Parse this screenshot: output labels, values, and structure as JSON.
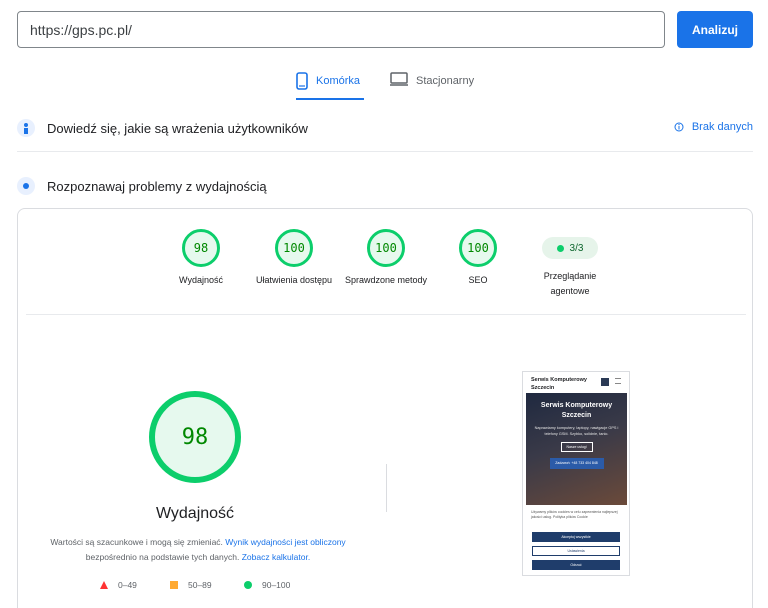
{
  "search": {
    "url": "https://gps.pc.pl/",
    "analyze_label": "Analizuj"
  },
  "tabs": [
    {
      "label": "Komórka",
      "icon": "smartphone-icon",
      "active": true
    },
    {
      "label": "Stacjonarny",
      "icon": "desktop-icon",
      "active": false
    }
  ],
  "sections": {
    "field": {
      "title": "Dowiedź się, jakie są wrażenia użytkowników",
      "status": "Brak danych"
    },
    "lab": {
      "title": "Rozpoznawaj problemy z wydajnością"
    }
  },
  "scores": [
    {
      "value": "98",
      "label": "Wydajność"
    },
    {
      "value": "100",
      "label": "Ułatwienia dostępu"
    },
    {
      "value": "100",
      "label": "Sprawdzone metody"
    },
    {
      "value": "100",
      "label": "SEO"
    },
    {
      "value": "3/3",
      "label": "Przeglądanie agentowe"
    }
  ],
  "performance": {
    "score": "98",
    "label": "Wydajność",
    "desc_pre": "Wartości są szacunkowe i mogą się zmieniać. ",
    "desc_link1": "Wynik wydajności jest obliczony",
    "desc_mid": " bezpośrednio na podstawie tych danych. ",
    "desc_link2": "Zobacz kalkulator."
  },
  "legend": [
    {
      "range": "0–49",
      "color": "#ff3333"
    },
    {
      "range": "50–89",
      "color": "#ffaa33"
    },
    {
      "range": "90–100",
      "color": "#0cce6b"
    }
  ],
  "preview": {
    "header": "Serwis Komputerowy Szczecin",
    "hero_title": "Serwis Komputerowy Szczecin",
    "hero_sub": "Naprawiamy komputery, laptopy, nawigacje GPS i telefony GSM. Szybko, solidnie, tanio.",
    "btn1": "Nasze usługi",
    "btn2": "Zadzwoń: +48 733 404 848",
    "body": "Używamy plików cookies w celu zapewnienia najlepszej jakości usług. Polityka plików Cookie",
    "bar1": "Akceptuj wszystkie",
    "bar2": "Ustawienia",
    "bar3": "Odrzuć"
  },
  "colors": {
    "accent": "#1a73e8",
    "pass": "#0cce6b",
    "average": "#ffaa33",
    "fail": "#ff3333"
  }
}
